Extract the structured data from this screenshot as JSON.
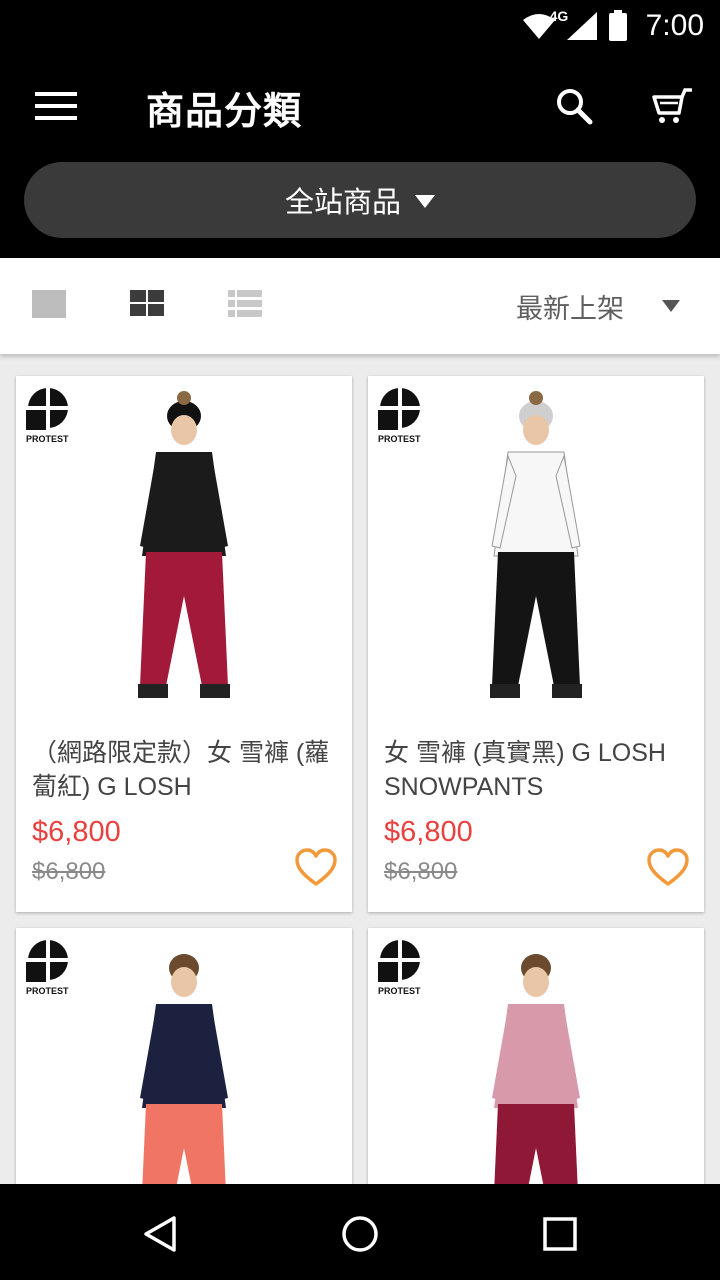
{
  "status_bar": {
    "network": "4G",
    "time": "7:00",
    "icons": [
      "wifi-icon",
      "cell-signal-icon",
      "battery-icon"
    ]
  },
  "app_bar": {
    "title": "商品分類",
    "icons": [
      "menu-icon",
      "search-icon",
      "cart-icon"
    ],
    "category_selector": {
      "selected": "全站商品"
    }
  },
  "toolbar": {
    "view_modes": [
      "single-view-icon",
      "grid-view-icon",
      "list-view-icon"
    ],
    "active_view": "grid-view-icon",
    "sort": {
      "selected": "最新上架"
    }
  },
  "products": [
    {
      "brand": "PROTEST",
      "name": "（網路限定款）女 雪褲 (蘿蔔紅) G LOSH",
      "price": "$6,800",
      "original_price": "$6,800",
      "top_color": "#1b1b1b",
      "pants_color": "#a3193a",
      "hat_color": "#111111"
    },
    {
      "brand": "PROTEST",
      "name": "女 雪褲 (真實黑) G LOSH SNOWPANTS",
      "price": "$6,800",
      "original_price": "$6,800",
      "top_color": "#f7f7f7",
      "pants_color": "#141414",
      "hat_color": "#cfcfcf"
    },
    {
      "brand": "PROTEST",
      "name": "",
      "price": "",
      "original_price": "",
      "top_color": "#1c2140",
      "pants_color": "#f07565",
      "hat_color": ""
    },
    {
      "brand": "PROTEST",
      "name": "",
      "price": "",
      "original_price": "",
      "top_color": "#d89aab",
      "pants_color": "#8f1837",
      "hat_color": ""
    }
  ],
  "colors": {
    "accent_price": "#e8413f",
    "favorite": "#f29a3a",
    "app_bar": "#000000",
    "selector_bg": "#3a3a3a"
  },
  "nav_bar": {
    "icons": [
      "back-icon",
      "home-icon",
      "recents-icon"
    ]
  }
}
